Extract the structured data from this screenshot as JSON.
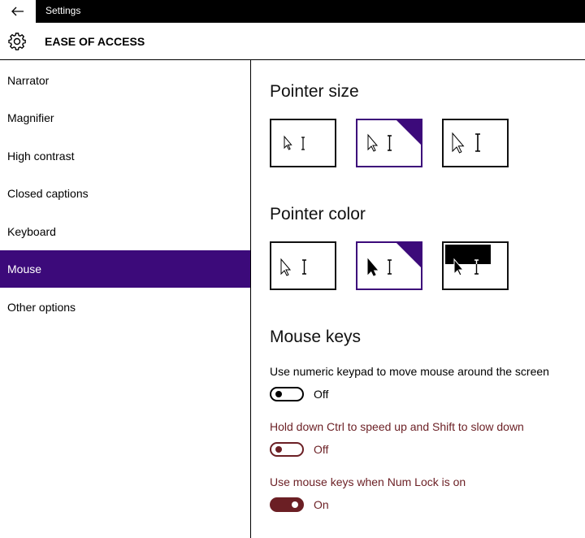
{
  "titlebar": {
    "title": "Settings"
  },
  "header": {
    "title": "EASE OF ACCESS"
  },
  "sidebar": {
    "items": [
      {
        "label": "Narrator"
      },
      {
        "label": "Magnifier"
      },
      {
        "label": "High contrast"
      },
      {
        "label": "Closed captions"
      },
      {
        "label": "Keyboard"
      },
      {
        "label": "Mouse"
      },
      {
        "label": "Other options"
      }
    ]
  },
  "main": {
    "pointer_size": {
      "title": "Pointer size"
    },
    "pointer_color": {
      "title": "Pointer color"
    },
    "mouse_keys": {
      "title": "Mouse keys",
      "settings": [
        {
          "label": "Use numeric keypad to move mouse around the screen",
          "state": "Off"
        },
        {
          "label": "Hold down Ctrl to speed up and Shift to slow down",
          "state": "Off"
        },
        {
          "label": "Use mouse keys when Num Lock is on",
          "state": "On"
        }
      ]
    }
  },
  "colors": {
    "accent": "#3c0a7a",
    "toggle_on": "#6b1f24",
    "setting_dim": "#6b1f24"
  },
  "icons": [
    "back-arrow-icon",
    "gear-icon",
    "checkmark-icon",
    "pointer-arrow-icon",
    "text-beam-icon"
  ]
}
